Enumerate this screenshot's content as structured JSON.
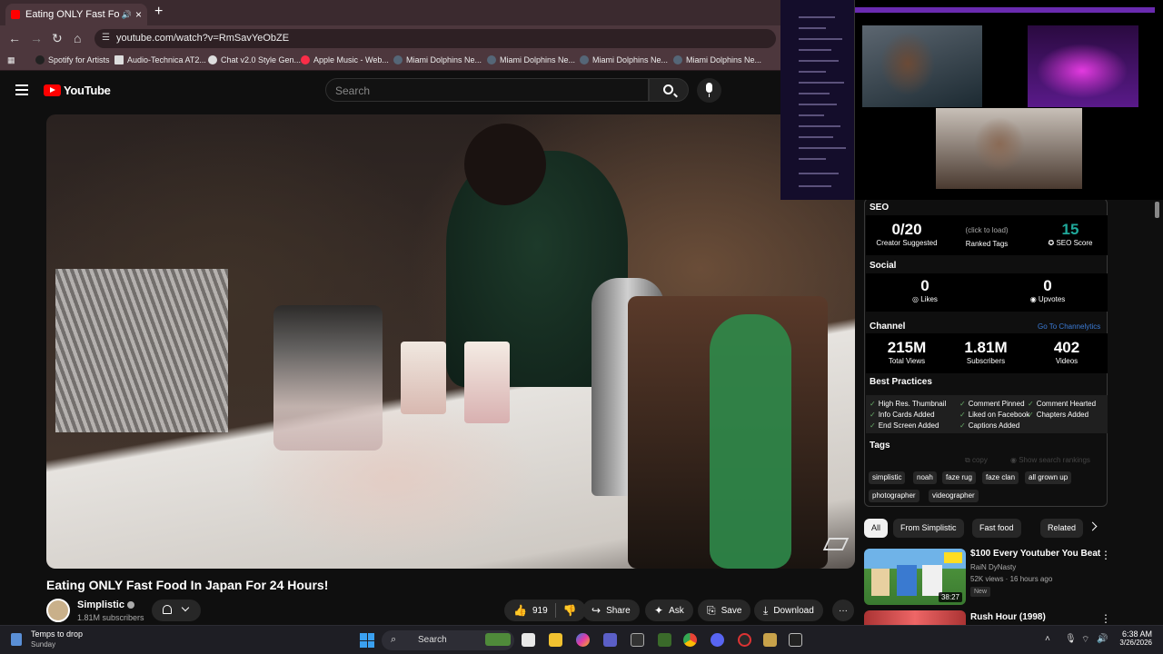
{
  "browser": {
    "tab_title": "Eating ONLY Fast Food In Japan",
    "new_tab": "+",
    "close": "×",
    "url": "youtube.com/watch?v=RmSavYeObZE",
    "bookmarks": [
      "Spotify for Artists",
      "Audio-Technica AT2...",
      "Chat v2.0 Style Gen...",
      "Apple Music - Web...",
      "Miami Dolphins Ne...",
      "Miami Dolphins Ne...",
      "Miami Dolphins Ne...",
      "Miami Dolphins Ne..."
    ]
  },
  "youtube": {
    "logo_text": "YouTube",
    "search_placeholder": "Search"
  },
  "video": {
    "title": "Eating ONLY Fast Food In Japan For 24 Hours!",
    "channel": "Simplistic",
    "subscribers": "1.81M subscribers",
    "likes": "919",
    "share": "Share",
    "ask": "Ask",
    "save": "Save",
    "download": "Download",
    "more": "···"
  },
  "seo_panel": {
    "seo_title": "SEO",
    "creator_suggested_value": "0/20",
    "creator_suggested_label": "Creator Suggested",
    "ranked_tags_hint": "(click to load)",
    "ranked_tags_label": "Ranked Tags",
    "seo_score_value": "15",
    "seo_score_label": "SEO Score",
    "social_title": "Social",
    "likes_value": "0",
    "likes_label": "Likes",
    "upvotes_value": "0",
    "upvotes_label": "Upvotes",
    "channel_title": "Channel",
    "channel_link": "Go To Channelytics",
    "total_views_value": "215M",
    "total_views_label": "Total Views",
    "subscribers_value": "1.81M",
    "subscribers_label": "Subscribers",
    "videos_value": "402",
    "videos_label": "Videos",
    "best_practices_title": "Best Practices",
    "best_practices": [
      "High Res. Thumbnail",
      "Comment Pinned",
      "Comment Hearted",
      "Info Cards Added",
      "Liked on Facebook",
      "Chapters Added",
      "End Screen Added",
      "Captions Added"
    ],
    "tags_title": "Tags",
    "copy_label": "copy",
    "show_rankings_label": "Show search rankings",
    "tags": [
      "simplistic",
      "noah",
      "faze rug",
      "faze clan",
      "all grown up",
      "photographer",
      "videographer"
    ],
    "accent_color": "#1fa89a"
  },
  "chips": [
    "All",
    "From Simplistic",
    "Fast food",
    "Related"
  ],
  "recommendations": [
    {
      "title": "$100 Every Youtuber You Beat",
      "channel": "RaiN DyNasty",
      "meta": "52K views · 16 hours ago",
      "badge": "New",
      "duration": "38:27"
    },
    {
      "title": "Rush Hour (1998)"
    }
  ],
  "taskbar": {
    "weather_title": "Temps to drop",
    "weather_sub": "Sunday",
    "search_label": "Search",
    "time": "6:38 AM",
    "date": "3/26/2026"
  }
}
